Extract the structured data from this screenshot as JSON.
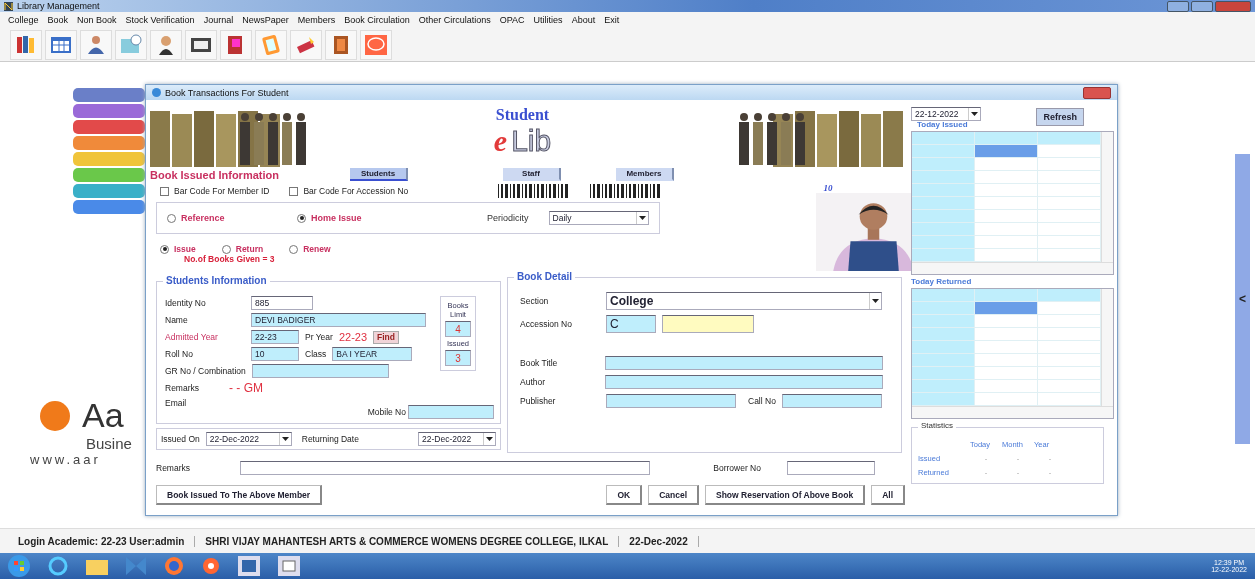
{
  "window": {
    "title": "Library Management"
  },
  "menu": [
    "College",
    "Book",
    "Non Book",
    "Stock Verification",
    "Journal",
    "NewsPaper",
    "Members",
    "Book Circulation",
    "Other Circulations",
    "OPAC",
    "Utilities",
    "About",
    "Exit"
  ],
  "desktop": {
    "logo_text": "Aa",
    "logo_subtitle": "Busine",
    "website": "www.aar",
    "side_tab": "<"
  },
  "dialog": {
    "title": "Book Transactions For Student",
    "logo": {
      "top": "Student",
      "e": "e",
      "lib": "Lib"
    },
    "section_title": "Book Issued Information",
    "tabs": [
      {
        "label": "Students",
        "selected": true
      },
      {
        "label": "Staff",
        "selected": false
      },
      {
        "label": "Members",
        "selected": false
      }
    ],
    "barcode_options": [
      {
        "label": "Bar Code For Member ID",
        "checked": false
      },
      {
        "label": "Bar Code For Accession No",
        "checked": false
      }
    ],
    "issue_type": [
      {
        "label": "Reference",
        "selected": false
      },
      {
        "label": "Home Issue",
        "selected": true
      }
    ],
    "periodicity": {
      "label": "Periodicity",
      "value": "Daily"
    },
    "transaction": [
      {
        "label": "Issue",
        "selected": true
      },
      {
        "label": "Return",
        "selected": false
      },
      {
        "label": "Renew",
        "selected": false
      }
    ],
    "books_given": "No.of Books Given  = 3",
    "member_number": "10",
    "student_info": {
      "title": "Students Information",
      "identity_label": "Identity No",
      "identity": "885",
      "name_label": "Name",
      "name": "DEVI BADIGER",
      "admitted_label": "Admitted Year",
      "admitted": "22-23",
      "pr_year_label": "Pr Year",
      "pr_year": "22-23",
      "find": "Find",
      "roll_label": "Roll No",
      "roll": "10",
      "class_label": "Class",
      "class": "BA  I YEAR",
      "gr_label": "GR No / Combination",
      "remarks_label": "Remarks",
      "remarks": "- - GM",
      "email_label": "Email",
      "mobile_label": "Mobile No",
      "limit_label": "Books Limit",
      "limit": "4",
      "issued_label": "Issued",
      "issued": "3"
    },
    "dates": {
      "issued_on_label": "Issued On",
      "issued_on": "22-Dec-2022",
      "returning_label": "Returning Date",
      "returning": "22-Dec-2022"
    },
    "book_detail": {
      "title": "Book Detail",
      "section_label": "Section",
      "section": "College",
      "accession_label": "Accession No",
      "accession": "C",
      "title_label": "Book Title",
      "author_label": "Author",
      "publisher_label": "Publisher",
      "call_no_label": "Call No"
    },
    "remarks_label": "Remarks",
    "borrower_label": "Borrower No",
    "buttons": [
      "Book Issued To The Above Member",
      "OK",
      "Cancel",
      "Show Reservation Of Above Book",
      "All"
    ],
    "side": {
      "date": "22-12-2022",
      "refresh": "Refresh",
      "issued_title": "Today Issued",
      "issued_grid": [
        {
          "selected": false
        },
        {
          "selected": true
        },
        {
          "selected": false
        },
        {
          "selected": false
        },
        {
          "selected": false
        },
        {
          "selected": false
        },
        {
          "selected": false
        },
        {
          "selected": false
        },
        {
          "selected": false
        },
        {
          "selected": false
        }
      ],
      "returned_title": "Today Returned",
      "returned_grid": [
        {
          "selected": false
        },
        {
          "selected": true
        },
        {
          "selected": false
        },
        {
          "selected": false
        },
        {
          "selected": false
        },
        {
          "selected": false
        },
        {
          "selected": false
        },
        {
          "selected": false
        },
        {
          "selected": false
        }
      ],
      "statistics": {
        "title": "Statistics",
        "columns": [
          "Today",
          "Month",
          "Year"
        ],
        "rows": [
          {
            "label": "Issued",
            "values": [
              "-",
              "-",
              "-"
            ]
          },
          {
            "label": "Returned",
            "values": [
              "-",
              "-",
              "-"
            ]
          }
        ]
      }
    }
  },
  "status_bar": [
    "Login Academic: 22-23  User:admin",
    "SHRI VIJAY MAHANTESH ARTS & COMMERCE WOMENS DEGREE COLLEGE, ILKAL",
    "22-Dec-2022"
  ],
  "taskbar": {
    "time": "12:39 PM",
    "date": "12-22-2022"
  }
}
